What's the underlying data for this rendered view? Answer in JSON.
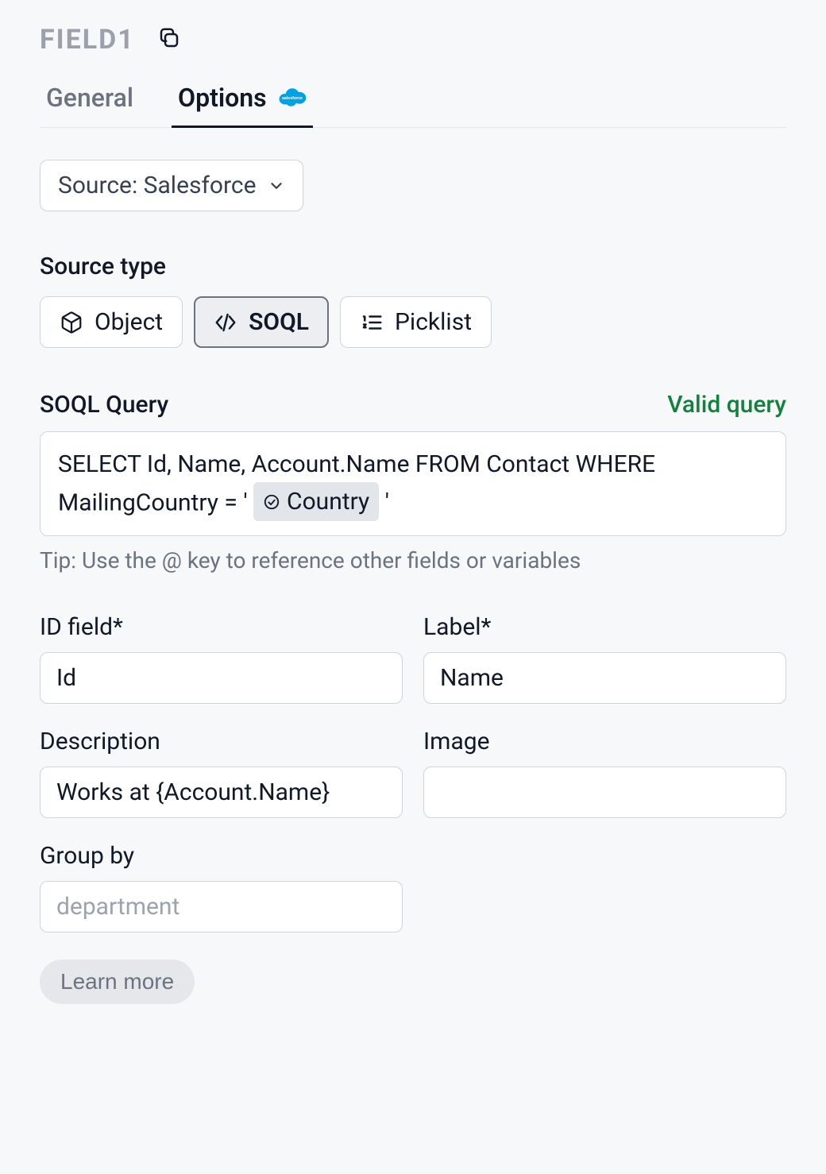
{
  "header": {
    "title": "FIELD1"
  },
  "tabs": {
    "general": "General",
    "options": "Options"
  },
  "source_select": {
    "label": "Source: Salesforce"
  },
  "source_type": {
    "label": "Source type",
    "options": {
      "object": "Object",
      "soql": "SOQL",
      "picklist": "Picklist"
    },
    "selected": "soql"
  },
  "soql": {
    "label": "SOQL Query",
    "status": "Valid query",
    "query_prefix": "SELECT Id, Name, Account.Name FROM Contact WHERE MailingCountry = '",
    "token": "Country",
    "query_suffix": "'",
    "tip": "Tip: Use the @ key to reference other fields or variables"
  },
  "fields": {
    "id_field": {
      "label": "ID field*",
      "value": "Id"
    },
    "label_field": {
      "label": "Label*",
      "value": "Name"
    },
    "description": {
      "label": "Description",
      "value": "Works at {Account.Name}"
    },
    "image": {
      "label": "Image",
      "value": ""
    },
    "group_by": {
      "label": "Group by",
      "placeholder": "department",
      "value": ""
    }
  },
  "learn_more": "Learn more"
}
